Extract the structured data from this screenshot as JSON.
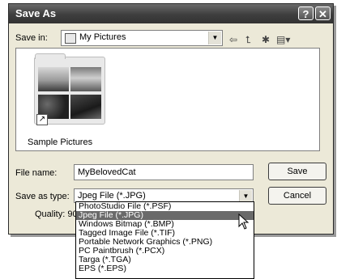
{
  "window": {
    "title": "Save As",
    "help_label": "?",
    "close_label": "✕"
  },
  "save_in": {
    "label": "Save in:",
    "value": "My Pictures",
    "icon": "pictures-folder-icon"
  },
  "toolbar": {
    "back_icon": "back-arrow-icon",
    "back_glyph": "⇦",
    "up_icon": "up-folder-icon",
    "up_glyph": "⮤",
    "newfolder_icon": "new-folder-icon",
    "newfolder_glyph": "✱",
    "views_icon": "views-menu-icon",
    "views_glyph": "▤▾"
  },
  "folders": [
    {
      "name": "Sample Pictures"
    }
  ],
  "file_name": {
    "label": "File name:",
    "value": "MyBelovedCat"
  },
  "save_as_type": {
    "label": "Save as type:",
    "value": "Jpeg File (*.JPG)"
  },
  "quality": {
    "label": "Quality: 90"
  },
  "buttons": {
    "save": "Save",
    "cancel": "Cancel"
  },
  "type_options": [
    {
      "label": "PhotoStudio File (*.PSF)",
      "selected": false
    },
    {
      "label": "Jpeg File (*.JPG)",
      "selected": true
    },
    {
      "label": "Windows Bitmap (*.BMP)",
      "selected": false
    },
    {
      "label": "Tagged Image File (*.TIF)",
      "selected": false
    },
    {
      "label": "Portable Network Graphics (*.PNG)",
      "selected": false
    },
    {
      "label": "PC Paintbrush (*.PCX)",
      "selected": false
    },
    {
      "label": "Targa (*.TGA)",
      "selected": false
    },
    {
      "label": "EPS (*.EPS)",
      "selected": false
    }
  ]
}
